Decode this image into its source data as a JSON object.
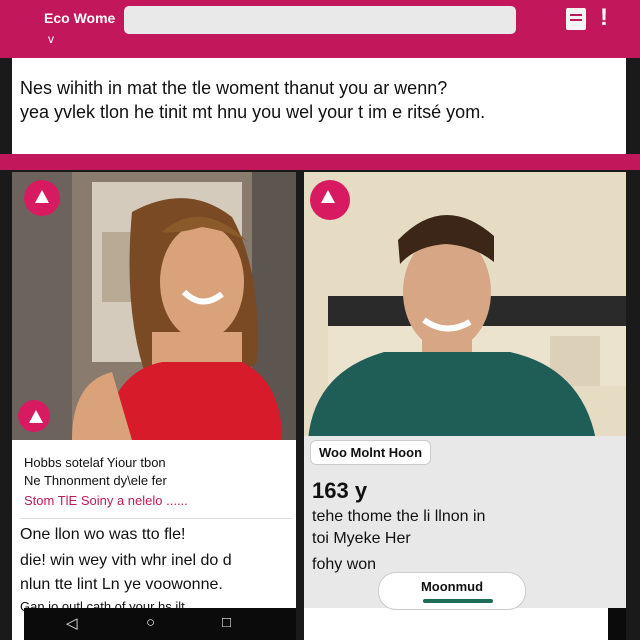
{
  "header": {
    "title": "Eco Wome",
    "chevron": "v"
  },
  "question": {
    "line1": "Nes wihith in mat the tle woment thanut you ar wenn?",
    "line2": "yea yvlek tlon he tinit mt hnu you wel your t im e ritsé yom."
  },
  "left_card": {
    "caption1": "Hobbs sotelaf Yiour tbon",
    "caption2": "Ne Thnonment dy\\ele fer",
    "caption3": "Stom TlE Soiny a nelelo ......",
    "body1": "One llon wo was tto fle!",
    "body2": "die! win wey vith whr inel do d",
    "body3": "nlun tte lint Ln ye voowonne.",
    "body4": "Gan io outl cath of your hs ilt."
  },
  "right_card": {
    "name_chip": "Woo Molnt Hoon",
    "age": "163 y",
    "line1": "tehe thome the li llnon in",
    "line2": "toi Myeke Her",
    "line3": "fohy won",
    "pill_label": "Moonmud"
  },
  "nav": {
    "back": "◁",
    "home": "○",
    "recents": "□"
  },
  "colors": {
    "accent": "#c2185b",
    "pill_bar": "#1e6b58"
  },
  "icons": [
    "menu-box-icon",
    "alert-icon",
    "triangle-badge-icon",
    "back-icon",
    "home-icon",
    "recents-icon"
  ]
}
